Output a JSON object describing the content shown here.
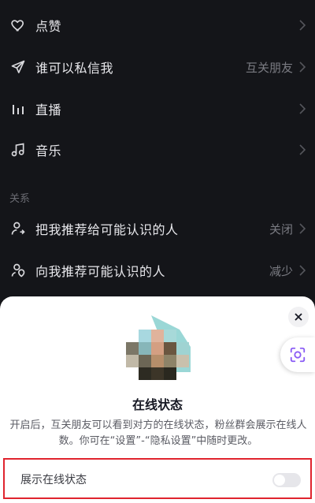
{
  "settings": {
    "items": [
      {
        "label": "点赞",
        "value": "",
        "icon": "heart-icon"
      },
      {
        "label": "谁可以私信我",
        "value": "互关朋友",
        "icon": "send-icon"
      },
      {
        "label": "直播",
        "value": "",
        "icon": "live-bars-icon"
      },
      {
        "label": "音乐",
        "value": "",
        "icon": "music-note-icon"
      }
    ],
    "relation_header": "关系",
    "relation_items": [
      {
        "label": "把我推荐给可能认识的人",
        "value": "关闭",
        "icon": "person-share-icon"
      },
      {
        "label": "向我推荐可能认识的人",
        "value": "减少",
        "icon": "person-location-icon"
      }
    ]
  },
  "sheet": {
    "title": "在线状态",
    "description": "开启后，互关朋友可以看到对方的在线状态，粉丝群会展示在线人数。你可在“设置”-“隐私设置”中随时更改。",
    "toggle_label": "展示在线状态",
    "toggle_on": false
  },
  "colors": {
    "background": "#141519",
    "sheet": "#ffffff",
    "highlight_border": "#e0242e",
    "scan_accent": "#8a5cf5"
  }
}
